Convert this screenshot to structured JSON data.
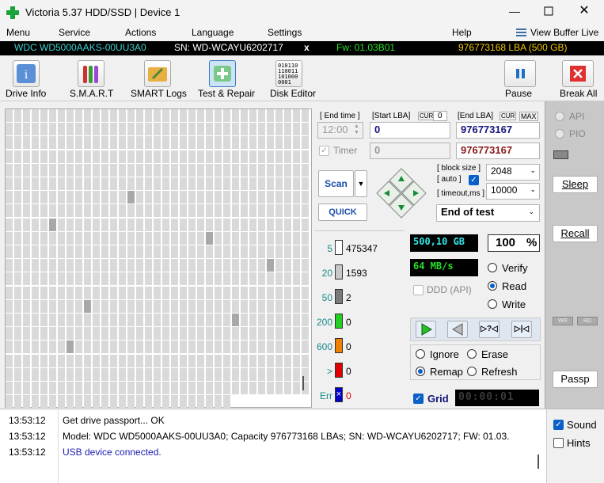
{
  "window": {
    "title": "Victoria 5.37 HDD/SSD | Device 1"
  },
  "menu": [
    "Menu",
    "Service",
    "Actions",
    "Language",
    "Settings",
    "Help"
  ],
  "view_buffer": "View Buffer Live",
  "drive": {
    "model": "WDC WD5000AAKS-00UU3A0",
    "sn": "SN: WD-WCAYU6202717",
    "close": "x",
    "fw": "Fw: 01.03B01",
    "lba": "976773168 LBA (500 GB)"
  },
  "toolbar": [
    "Drive Info",
    "S.M.A.R.T",
    "SMART Logs",
    "Test & Repair",
    "Disk Editor",
    "Pause",
    "Break All"
  ],
  "disk_editor_icon": [
    "010110",
    "110011",
    "101000",
    "0001"
  ],
  "controls": {
    "end_time_label": "[ End time ]",
    "start_lba_label": "[Start LBA]",
    "cur": "CUR",
    "start_cur": "0",
    "end_lba_label": "[End LBA]",
    "cur2": "CUR",
    "max": "MAX",
    "end_time": "12:00",
    "start_lba": "0",
    "end_lba": "976773167",
    "timer_label": "Timer",
    "timer_value": "0",
    "end_lba2": "976773167",
    "scan": "Scan",
    "quick": "QUICK",
    "block_size_label": "[ block size ]",
    "auto_label": "[ auto ]",
    "timeout_label": "[ timeout,ms ]",
    "block_size": "2048",
    "timeout": "10000",
    "end_mode": "End of test"
  },
  "stats": [
    {
      "label": "5",
      "count": "475347",
      "color": "#ffffff"
    },
    {
      "label": "20",
      "count": "1593",
      "color": "#c8c8c8"
    },
    {
      "label": "50",
      "count": "2",
      "color": "#7a7a7a"
    },
    {
      "label": "200",
      "count": "0",
      "color": "#22d022"
    },
    {
      "label": "600",
      "count": "0",
      "color": "#f08000"
    },
    {
      "label": ">",
      "count": "0",
      "color": "#e00000"
    },
    {
      "label": "Err",
      "count": "0",
      "color": "#0000c8"
    }
  ],
  "readouts": {
    "size": "500,10 GB",
    "percent": "100",
    "percent_unit": "%",
    "speed": "64 MB/s",
    "ddd": "DDD (API)",
    "time": "00:00:01"
  },
  "modes": {
    "verify": "Verify",
    "read": "Read",
    "write": "Write",
    "selected": "Read"
  },
  "actions": {
    "ignore": "Ignore",
    "erase": "Erase",
    "remap": "Remap",
    "refresh": "Refresh",
    "selected": "Remap"
  },
  "grid_label": "Grid",
  "right": {
    "api": "API",
    "pio": "PIO",
    "sleep": "Sleep",
    "recall": "Recall",
    "wr": "WR",
    "rd": "RD",
    "passp": "Passp"
  },
  "log": [
    {
      "time": "13:53:12",
      "text": "Get drive passport... OK",
      "color": "#000000"
    },
    {
      "time": "13:53:12",
      "text": "Model: WDC WD5000AAKS-00UU3A0; Capacity 976773168 LBAs; SN: WD-WCAYU6202717; FW: 01.03.",
      "color": "#000000"
    },
    {
      "time": "13:53:12",
      "text": "USB device connected.",
      "color": "#1a1ab4"
    }
  ],
  "opts": {
    "sound": "Sound",
    "hints": "Hints"
  },
  "colors": {
    "accent": "#0a5fc8",
    "lcd_green": "#25e025",
    "lcd_cyan": "#30e8e8"
  }
}
